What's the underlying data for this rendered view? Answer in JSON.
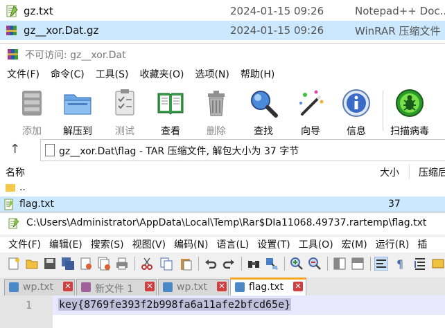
{
  "explorer": {
    "rows": [
      {
        "name": "gz.txt",
        "date": "2024-01-15 09:26",
        "type": "Notepad++ Doc..."
      },
      {
        "name": "gz__xor.Dat.gz",
        "date": "2024-01-15 09:26",
        "type": "WinRAR 压缩文件"
      }
    ]
  },
  "winrar": {
    "title": "不可访问: gz__xor.Dat",
    "menu": [
      "文件(F)",
      "命令(C)",
      "工具(S)",
      "收藏夹(O)",
      "选项(N)",
      "帮助(H)"
    ],
    "toolbar": {
      "add": "添加",
      "extract": "解压到",
      "test": "测试",
      "view": "查看",
      "delete": "删除",
      "find": "查找",
      "wizard": "向导",
      "info": "信息",
      "scan": "扫描病毒"
    },
    "path": "gz__xor.Dat\\flag - TAR 压缩文件, 解包大小为 37 字节",
    "columns": {
      "name": "名称",
      "size": "大小",
      "packed": "压缩后"
    },
    "files": [
      {
        "name": "..",
        "size": ""
      },
      {
        "name": "flag.txt",
        "size": "37"
      }
    ]
  },
  "notepad": {
    "title": "C:\\Users\\Administrator\\AppData\\Local\\Temp\\Rar$DIa11068.49737.rartemp\\flag.txt",
    "menu": [
      "文件(F)",
      "编辑(E)",
      "搜索(S)",
      "视图(V)",
      "编码(N)",
      "语言(L)",
      "设置(T)",
      "工具(O)",
      "宏(M)",
      "运行(R)",
      "插"
    ],
    "tabs": [
      {
        "label": "wp.txt",
        "active": false
      },
      {
        "label": "新文件 1",
        "active": false
      },
      {
        "label": "wp.txt",
        "active": false
      },
      {
        "label": "flag.txt",
        "active": true
      }
    ],
    "close_glyph": "✕",
    "line_number": "1",
    "content": "key{8769fe393f2b998fa6a11afe2bfcd65e}"
  }
}
